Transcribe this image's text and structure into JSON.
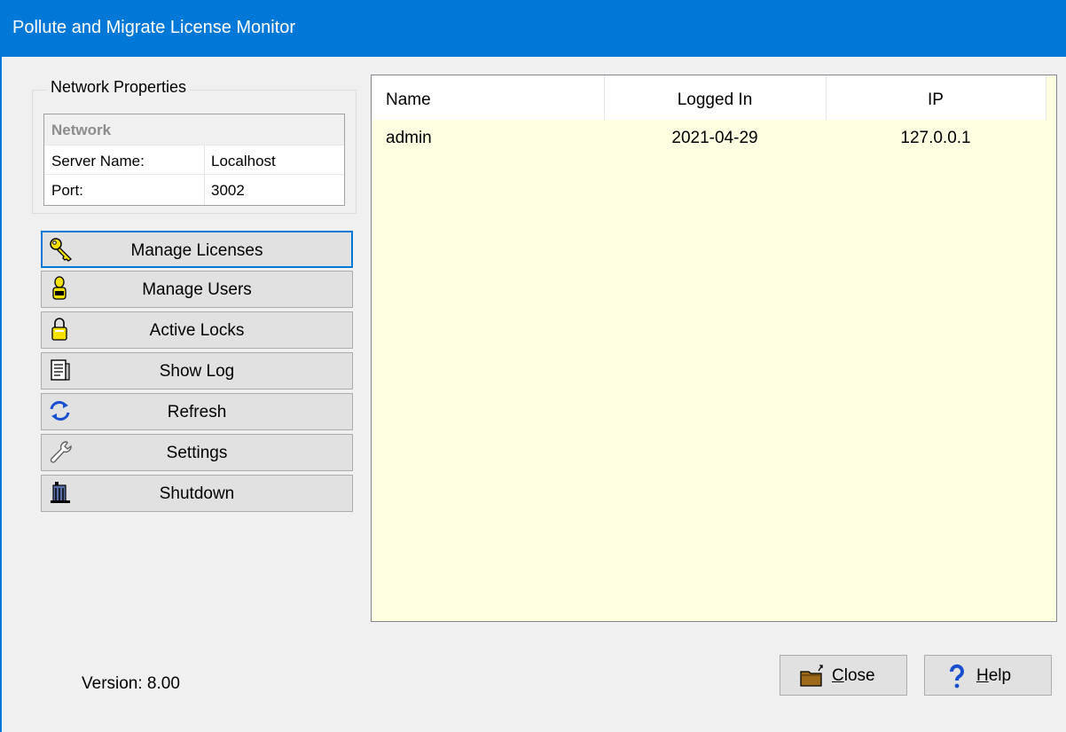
{
  "window": {
    "title": "Pollute and Migrate License Monitor"
  },
  "network": {
    "group_label": "Network Properties",
    "header": "Network",
    "rows": [
      {
        "key": "Server Name:",
        "value": "Localhost"
      },
      {
        "key": "Port:",
        "value": "3002"
      }
    ]
  },
  "actions": [
    {
      "label": "Manage Licenses",
      "icon": "key-icon"
    },
    {
      "label": "Manage Users",
      "icon": "user-icon"
    },
    {
      "label": "Active Locks",
      "icon": "lock-icon"
    },
    {
      "label": "Show Log",
      "icon": "log-icon"
    },
    {
      "label": "Refresh",
      "icon": "refresh-icon"
    },
    {
      "label": "Settings",
      "icon": "wrench-icon"
    },
    {
      "label": "Shutdown",
      "icon": "shutdown-icon"
    }
  ],
  "users_list": {
    "columns": [
      "Name",
      "Logged In",
      "IP"
    ],
    "rows": [
      {
        "name": "admin",
        "logged_in": "2021-04-29",
        "ip": "127.0.0.1"
      }
    ]
  },
  "footer": {
    "version": "Version: 8.00",
    "close_accel": "C",
    "close_rest": "lose",
    "help_accel": "H",
    "help_rest": "elp"
  },
  "colors": {
    "titlebar": "#0078d7",
    "list_background": "#ffffe1",
    "focus_border": "#0078d7"
  }
}
